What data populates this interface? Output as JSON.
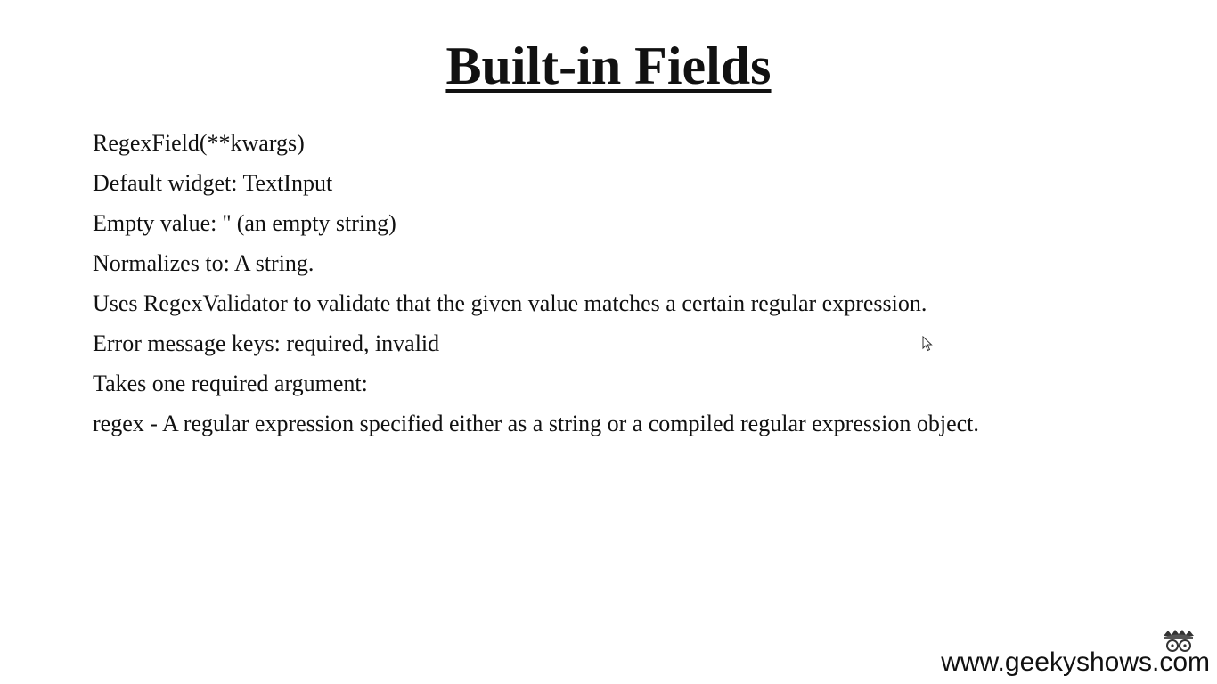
{
  "slide": {
    "title": "Built-in Fields",
    "lines": [
      "RegexField(**kwargs)",
      "Default widget: TextInput",
      "Empty value: '' (an empty string)",
      "Normalizes to: A string.",
      "Uses RegexValidator to validate that the given value matches a certain regular expression.",
      "Error message keys: required, invalid",
      "Takes one required argument:",
      "regex - A regular expression specified either as a string or a compiled regular expression object."
    ]
  },
  "branding": {
    "website": "www.geekyshows.com",
    "logo_icon": "geeky-face-logo-icon"
  },
  "overlay": {
    "cursor_icon": "mouse-pointer-icon"
  }
}
